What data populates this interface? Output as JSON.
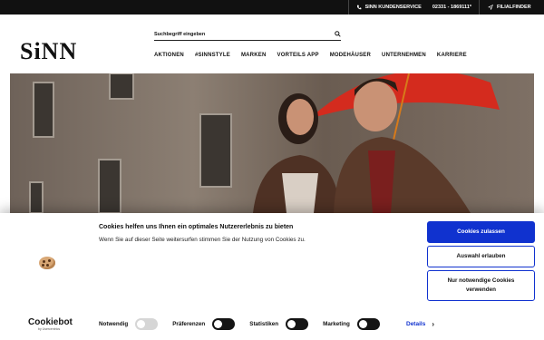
{
  "topbar": {
    "service_label": "SINN KUNDENSERVICE",
    "service_phone": "02331 - 1869111*",
    "store_finder": "FILIALFINDER"
  },
  "logo": "SiNN",
  "search": {
    "placeholder": "Suchbegriff eingeben"
  },
  "nav": [
    "AKTIONEN",
    "#SINNSTYLE",
    "MARKEN",
    "VORTEILS APP",
    "MODEHÄUSER",
    "UNTERNEHMEN",
    "KARRIERE"
  ],
  "cookie_banner": {
    "title": "Cookies helfen uns Ihnen ein optimales Nutzererlebnis zu bieten",
    "text": "Wenn Sie auf dieser Seite weitersurfen stimmen Sie der Nutzung von Cookies zu.",
    "buttons": {
      "allow_all": "Cookies zulassen",
      "allow_selection": "Auswahl erlauben",
      "necessary_only": "Nur notwendige Cookies verwenden"
    },
    "toggles": [
      "Notwendig",
      "Präferenzen",
      "Statistiken",
      "Marketing"
    ],
    "details": "Details",
    "brand": "Cookiebot",
    "brand_sub": "by Usercentrics"
  },
  "colors": {
    "accent": "#1032cf",
    "topbar": "#111111",
    "umbrella": "#d42b1e"
  }
}
